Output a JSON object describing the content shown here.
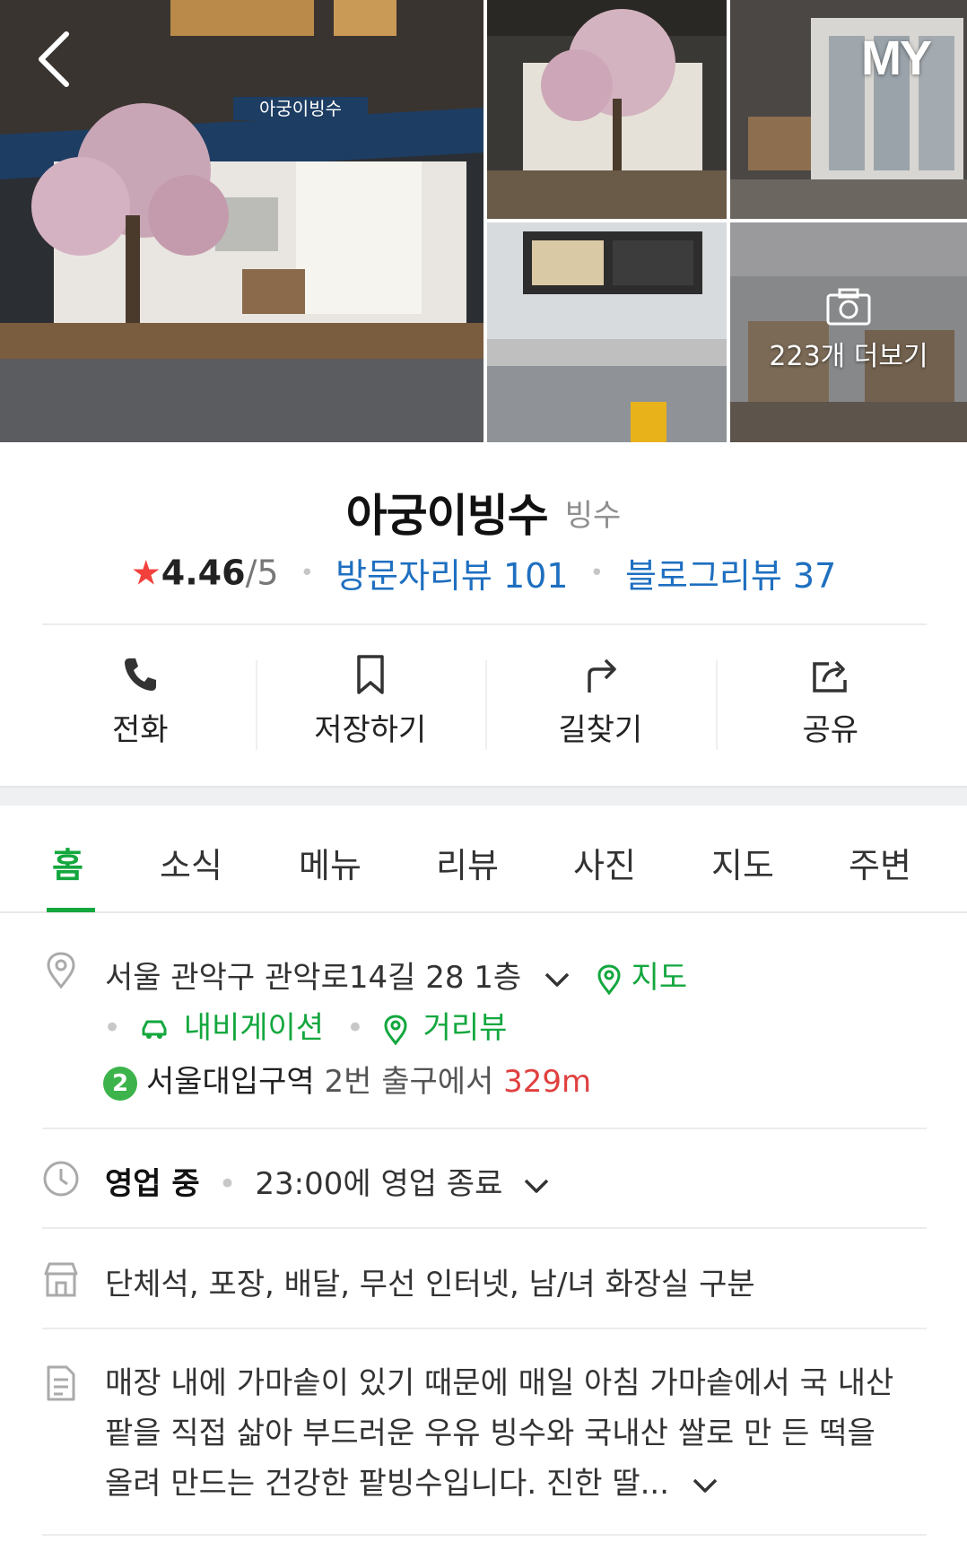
{
  "header": {
    "back_icon": "chevron-left-icon",
    "my_label": "MY"
  },
  "gallery": {
    "photo_count_label": "223개 더보기",
    "sign_text": "아궁이빙수",
    "camera_icon": "camera-icon"
  },
  "place": {
    "name": "아궁이빙수",
    "category": "빙수",
    "rating": "4.46",
    "rating_max": "/5",
    "visitor_reviews": "방문자리뷰 101",
    "blog_reviews": "블로그리뷰 37"
  },
  "actions": [
    {
      "label": "전화",
      "icon": "phone-icon"
    },
    {
      "label": "저장하기",
      "icon": "bookmark-icon"
    },
    {
      "label": "길찾기",
      "icon": "directions-icon"
    },
    {
      "label": "공유",
      "icon": "share-icon"
    }
  ],
  "tabs": [
    {
      "label": "홈",
      "active": true
    },
    {
      "label": "소식"
    },
    {
      "label": "메뉴"
    },
    {
      "label": "리뷰"
    },
    {
      "label": "사진"
    },
    {
      "label": "지도"
    },
    {
      "label": "주변"
    }
  ],
  "address": {
    "text": "서울 관악구 관악로14길 28 1층",
    "map_label": "지도",
    "navigation_label": "내비게이션",
    "street_view_label": "거리뷰",
    "subway_line": "2",
    "station": "서울대입구역",
    "exit_text": "2번 출구에서",
    "distance": "329m"
  },
  "hours": {
    "status": "영업 중",
    "closing": "23:00에 영업 종료"
  },
  "amenities": "단체석, 포장, 배달, 무선 인터넷, 남/녀 화장실 구분",
  "description": "매장 내에 가마솥이 있기 때문에 매일 아침 가마솥에서 국 내산 팥을 직접 삶아 부드러운 우유 빙수와 국내산 쌀로 만 든 떡을 올려 만드는 건강한 팥빙수입니다. 진한 딸...",
  "colors": {
    "accent_green": "#13a73e",
    "link_blue": "#1e6fc0",
    "star_red": "#f2413c",
    "distance_red": "#e04040"
  }
}
